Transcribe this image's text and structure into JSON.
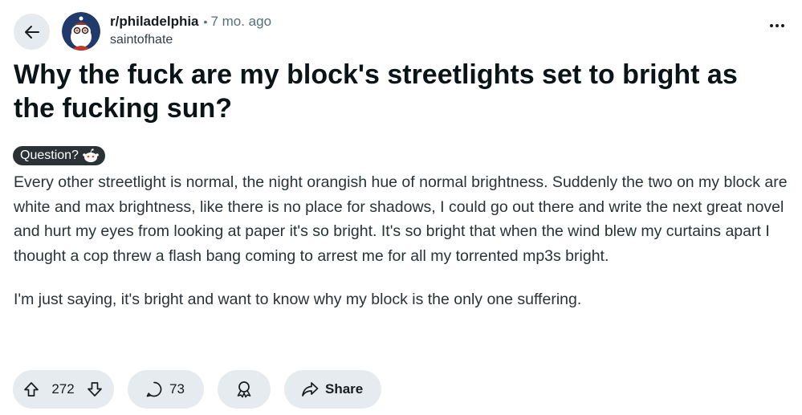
{
  "header": {
    "subreddit": "r/philadelphia",
    "separator": "•",
    "time_ago": "7 mo. ago",
    "author": "saintofhate"
  },
  "post": {
    "title": "Why the fuck are my block's streetlights set to bright as the fucking sun?",
    "flair": "Question?",
    "body": [
      "Every other streetlight is normal, the night orangish hue of normal brightness. Suddenly the two on my block are white and max brightness, like there is no place for shadows, I could go out there and write the next great novel and hurt my eyes from looking at paper it's so bright. It's so bright that when the wind blew my curtains apart I thought a cop threw a flash bang coming to arrest me for all my torrented mp3s bright.",
      "I'm just saying, it's bright and want to know why my block is the only one suffering."
    ]
  },
  "actions": {
    "votes": "272",
    "comments": "73",
    "share_label": "Share"
  },
  "icons": {
    "back": "arrow-left-icon",
    "more": "ellipsis-icon",
    "upvote": "arrow-up-icon",
    "downvote": "arrow-down-icon",
    "comment": "speech-bubble-icon",
    "award": "award-ribbon-icon",
    "share": "share-arrow-icon"
  },
  "colors": {
    "button_bg": "#e5ebee",
    "flair_bg": "#2a3236",
    "avatar_bg": "#1f3a6b"
  }
}
